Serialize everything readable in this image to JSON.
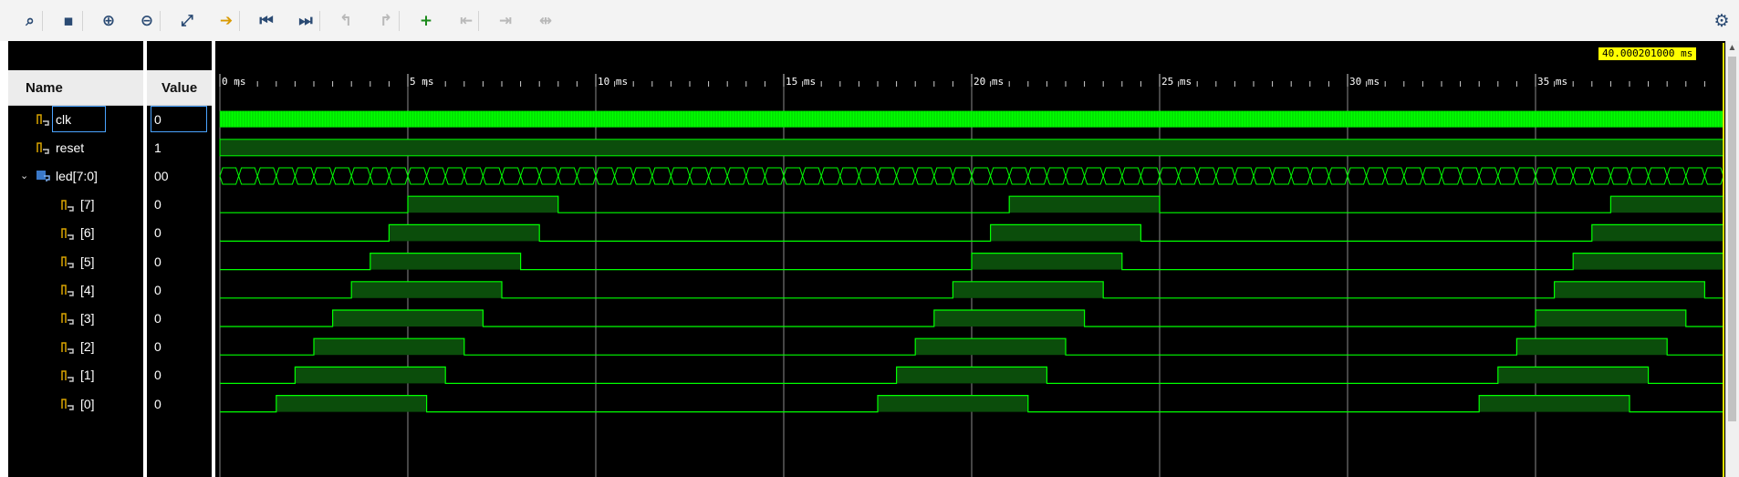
{
  "toolbar": {
    "buttons": [
      {
        "name": "search-icon",
        "glyph": "⌕",
        "style": ""
      },
      {
        "name": "save-icon",
        "glyph": "▪",
        "style": ""
      },
      {
        "name": "zoom-in-icon",
        "glyph": "⊕",
        "style": ""
      },
      {
        "name": "zoom-out-icon",
        "glyph": "⊖",
        "style": ""
      },
      {
        "name": "zoom-fit-icon",
        "glyph": "⤢",
        "style": ""
      },
      {
        "name": "go-to-cursor-icon",
        "glyph": "➔",
        "style": "gold"
      },
      {
        "name": "go-to-time-zero-icon",
        "glyph": "⏮",
        "style": ""
      },
      {
        "name": "go-to-last-time-icon",
        "glyph": "⏭",
        "style": ""
      },
      {
        "name": "previous-transition-icon",
        "glyph": "↰",
        "style": "disabled"
      },
      {
        "name": "next-transition-icon",
        "glyph": "↱",
        "style": "disabled"
      },
      {
        "name": "add-marker-icon",
        "glyph": "+",
        "style": "green"
      },
      {
        "name": "previous-marker-icon",
        "glyph": "⇤",
        "style": "disabled"
      },
      {
        "name": "next-marker-icon",
        "glyph": "⇥",
        "style": "disabled"
      },
      {
        "name": "swap-cursors-icon",
        "glyph": "⇹",
        "style": "disabled"
      }
    ],
    "settings_icon": "gear-icon"
  },
  "headers": {
    "name": "Name",
    "value": "Value"
  },
  "signals": [
    {
      "id": "clk",
      "label": "clk",
      "value": "0",
      "icon": "single-bit-signal-icon",
      "kind": "clock"
    },
    {
      "id": "reset",
      "label": "reset",
      "value": "1",
      "icon": "single-bit-signal-icon",
      "kind": "high"
    },
    {
      "id": "led",
      "label": "led[7:0]",
      "value": "00",
      "icon": "bus-signal-icon",
      "kind": "bus",
      "expanded": true
    },
    {
      "id": "led7",
      "label": "[7]",
      "value": "0",
      "icon": "single-bit-signal-icon",
      "kind": "bit",
      "rise_ms": 5.0,
      "period_ms": 16.0,
      "high_ms": 4.0
    },
    {
      "id": "led6",
      "label": "[6]",
      "value": "0",
      "icon": "single-bit-signal-icon",
      "kind": "bit",
      "rise_ms": 4.5,
      "period_ms": 16.0,
      "high_ms": 4.0
    },
    {
      "id": "led5",
      "label": "[5]",
      "value": "0",
      "icon": "single-bit-signal-icon",
      "kind": "bit",
      "rise_ms": 4.0,
      "period_ms": 16.0,
      "high_ms": 4.0
    },
    {
      "id": "led4",
      "label": "[4]",
      "value": "0",
      "icon": "single-bit-signal-icon",
      "kind": "bit",
      "rise_ms": 3.5,
      "period_ms": 16.0,
      "high_ms": 4.0
    },
    {
      "id": "led3",
      "label": "[3]",
      "value": "0",
      "icon": "single-bit-signal-icon",
      "kind": "bit",
      "rise_ms": 3.0,
      "period_ms": 16.0,
      "high_ms": 4.0
    },
    {
      "id": "led2",
      "label": "[2]",
      "value": "0",
      "icon": "single-bit-signal-icon",
      "kind": "bit",
      "rise_ms": 2.5,
      "period_ms": 16.0,
      "high_ms": 4.0
    },
    {
      "id": "led1",
      "label": "[1]",
      "value": "0",
      "icon": "single-bit-signal-icon",
      "kind": "bit",
      "rise_ms": 2.0,
      "period_ms": 16.0,
      "high_ms": 4.0
    },
    {
      "id": "led0",
      "label": "[0]",
      "value": "0",
      "icon": "single-bit-signal-icon",
      "kind": "bit",
      "rise_ms": 1.5,
      "period_ms": 16.0,
      "high_ms": 4.0
    }
  ],
  "timeline": {
    "ticks": [
      "0 ms",
      "5 ms",
      "10 ms",
      "15 ms",
      "20 ms",
      "25 ms",
      "30 ms",
      "35 ms"
    ],
    "range_ms": [
      0,
      40.0002
    ],
    "cursor_label": "40.000201000 ms",
    "cursor_ms": 40.0002
  },
  "colors": {
    "waveform": "#00ff00",
    "waveform_fill": "#0b4d0b",
    "grid": "#8a8a8a",
    "cursor": "#ffff00",
    "background": "#000000"
  }
}
